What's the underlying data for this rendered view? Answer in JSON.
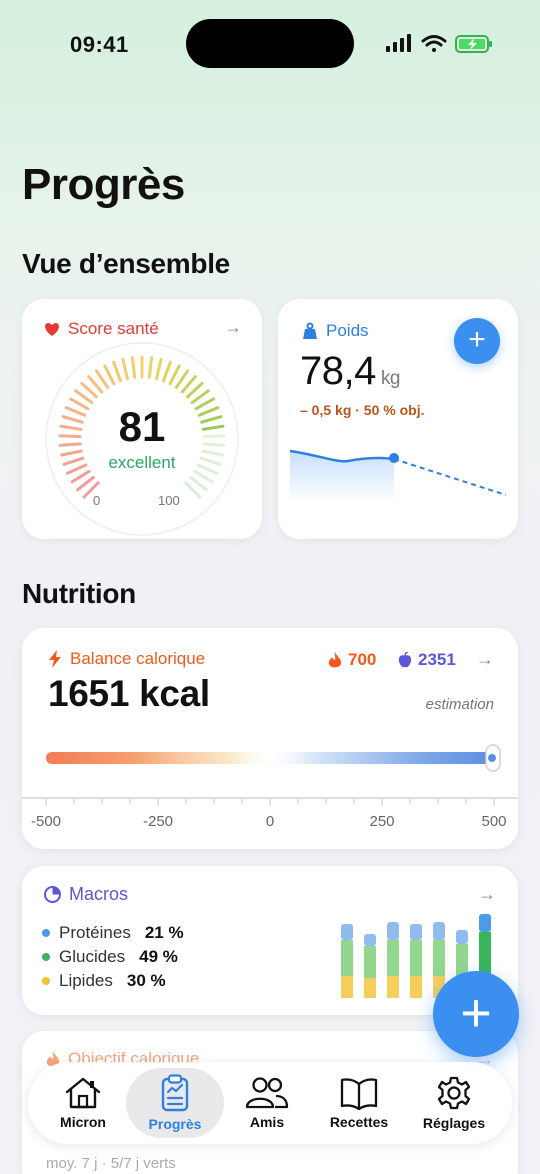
{
  "status": {
    "time": "09:41"
  },
  "page_title": "Progrès",
  "overview": {
    "heading": "Vue d’ensemble",
    "health": {
      "title": "Score santé",
      "score": "81",
      "rating": "excellent",
      "min": "0",
      "max": "100",
      "value": 81
    },
    "weight": {
      "title": "Poids",
      "value": "78,4",
      "unit": "kg",
      "delta": "– 0,5 kg · 50 % obj."
    }
  },
  "nutrition": {
    "heading": "Nutrition",
    "balance": {
      "title": "Balance calorique",
      "burned": "700",
      "consumed": "2351",
      "value": "1651 kcal",
      "note": "estimation",
      "ticks": [
        "-500",
        "-250",
        "0",
        "250",
        "500"
      ]
    },
    "macros": {
      "title": "Macros",
      "items": [
        {
          "name": "Protéines",
          "pct": "21 %",
          "color": "#4b9be8"
        },
        {
          "name": "Glucides",
          "pct": "49 %",
          "color": "#3ab55b"
        },
        {
          "name": "Lipides",
          "pct": "30 %",
          "color": "#f2c230"
        }
      ]
    },
    "goal": {
      "title": "Objectif calorique",
      "footer": "moy. 7 j · 5/7 j verts"
    }
  },
  "tabs": [
    {
      "label": "Micron",
      "icon": "home-icon"
    },
    {
      "label": "Progrès",
      "icon": "clipboard-chart-icon",
      "active": true
    },
    {
      "label": "Amis",
      "icon": "people-icon"
    },
    {
      "label": "Recettes",
      "icon": "book-icon"
    },
    {
      "label": "Réglages",
      "icon": "gear-icon"
    }
  ],
  "colors": {
    "accent": "#3a8ff0",
    "health": "#e53935",
    "balance": "#f05a1a",
    "macros": "#5b57d6",
    "delta": "#b7561a",
    "good": "#2aa865"
  }
}
